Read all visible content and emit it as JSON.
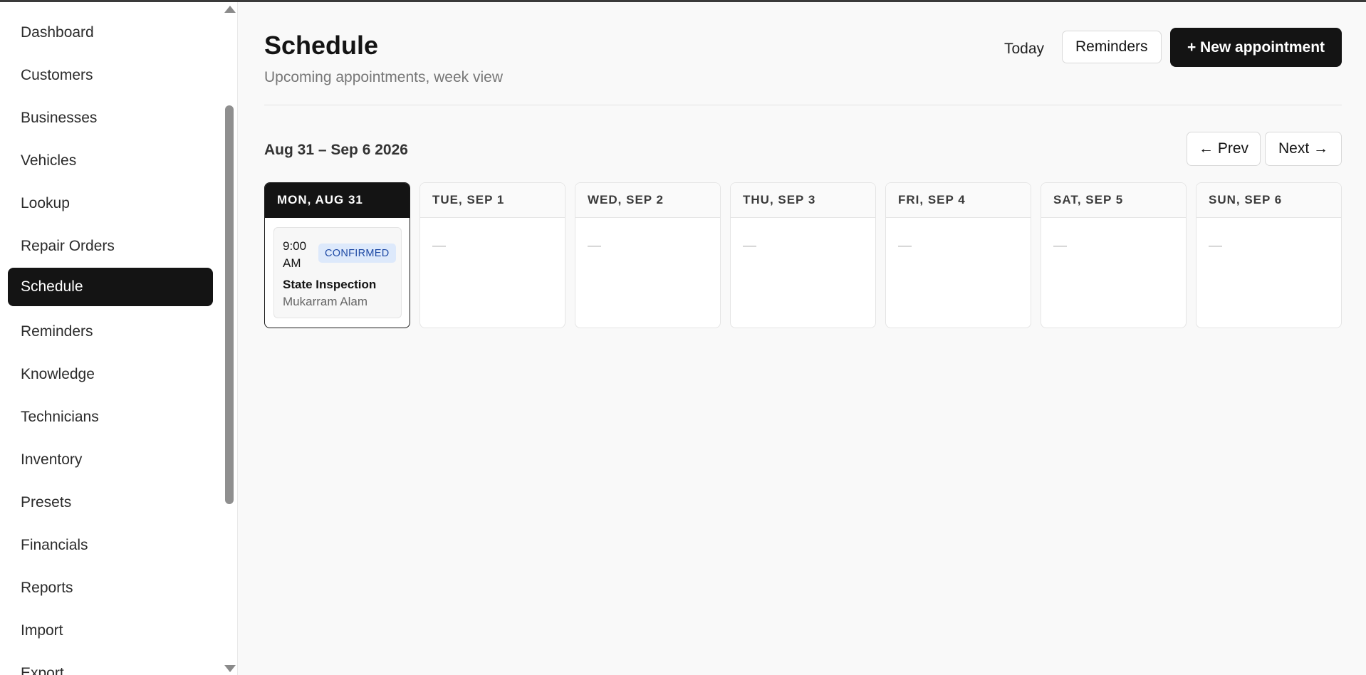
{
  "sidebar": {
    "items": [
      {
        "label": "Dashboard"
      },
      {
        "label": "Customers"
      },
      {
        "label": "Businesses"
      },
      {
        "label": "Vehicles"
      },
      {
        "label": "Lookup"
      },
      {
        "label": "Repair Orders"
      },
      {
        "label": "Schedule",
        "active": true
      },
      {
        "label": "Reminders"
      },
      {
        "label": "Knowledge"
      },
      {
        "label": "Technicians"
      },
      {
        "label": "Inventory"
      },
      {
        "label": "Presets"
      },
      {
        "label": "Financials"
      },
      {
        "label": "Reports"
      },
      {
        "label": "Import"
      },
      {
        "label": "Export"
      }
    ]
  },
  "header": {
    "title": "Schedule",
    "subtitle": "Upcoming appointments, week view",
    "today_label": "Today",
    "reminders_label": "Reminders",
    "new_appointment_label": "+ New appointment"
  },
  "week": {
    "range": "Aug 31 – Sep 6 2026",
    "prev_label": "← Prev",
    "next_label": "Next →",
    "days": [
      {
        "label": "MON, AUG 31",
        "today": true
      },
      {
        "label": "TUE, SEP 1",
        "empty": "—"
      },
      {
        "label": "WED, SEP 2",
        "empty": "—"
      },
      {
        "label": "THU, SEP 3",
        "empty": "—"
      },
      {
        "label": "FRI, SEP 4",
        "empty": "—"
      },
      {
        "label": "SAT, SEP 5",
        "empty": "—"
      },
      {
        "label": "SUN, SEP 6",
        "empty": "—"
      }
    ],
    "appointment": {
      "time": "9:00 AM",
      "status": "CONFIRMED",
      "title": "State Inspection",
      "customer": "Mukarram Alam"
    }
  },
  "colors": {
    "accent": "#141414",
    "status_confirmed_bg": "#dde9fb",
    "status_confirmed_text": "#1f4aa5"
  }
}
